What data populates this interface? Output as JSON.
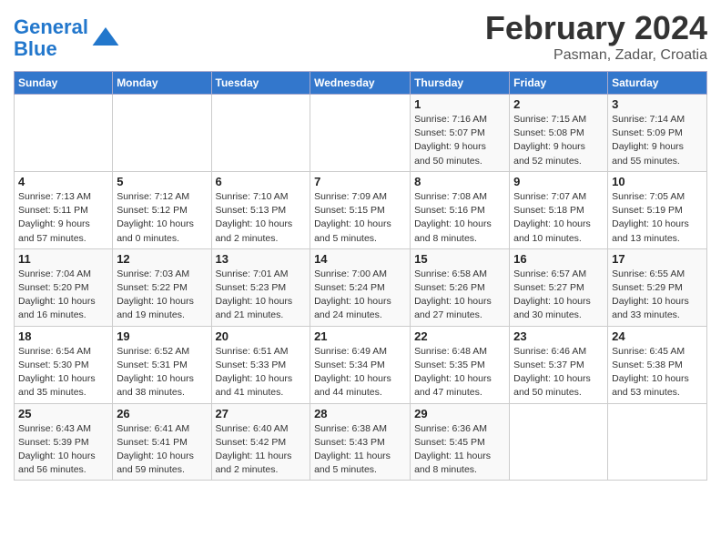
{
  "logo": {
    "line1": "General",
    "line2": "Blue"
  },
  "title": "February 2024",
  "location": "Pasman, Zadar, Croatia",
  "days_of_week": [
    "Sunday",
    "Monday",
    "Tuesday",
    "Wednesday",
    "Thursday",
    "Friday",
    "Saturday"
  ],
  "weeks": [
    [
      {
        "day": "",
        "info": ""
      },
      {
        "day": "",
        "info": ""
      },
      {
        "day": "",
        "info": ""
      },
      {
        "day": "",
        "info": ""
      },
      {
        "day": "1",
        "info": "Sunrise: 7:16 AM\nSunset: 5:07 PM\nDaylight: 9 hours\nand 50 minutes."
      },
      {
        "day": "2",
        "info": "Sunrise: 7:15 AM\nSunset: 5:08 PM\nDaylight: 9 hours\nand 52 minutes."
      },
      {
        "day": "3",
        "info": "Sunrise: 7:14 AM\nSunset: 5:09 PM\nDaylight: 9 hours\nand 55 minutes."
      }
    ],
    [
      {
        "day": "4",
        "info": "Sunrise: 7:13 AM\nSunset: 5:11 PM\nDaylight: 9 hours\nand 57 minutes."
      },
      {
        "day": "5",
        "info": "Sunrise: 7:12 AM\nSunset: 5:12 PM\nDaylight: 10 hours\nand 0 minutes."
      },
      {
        "day": "6",
        "info": "Sunrise: 7:10 AM\nSunset: 5:13 PM\nDaylight: 10 hours\nand 2 minutes."
      },
      {
        "day": "7",
        "info": "Sunrise: 7:09 AM\nSunset: 5:15 PM\nDaylight: 10 hours\nand 5 minutes."
      },
      {
        "day": "8",
        "info": "Sunrise: 7:08 AM\nSunset: 5:16 PM\nDaylight: 10 hours\nand 8 minutes."
      },
      {
        "day": "9",
        "info": "Sunrise: 7:07 AM\nSunset: 5:18 PM\nDaylight: 10 hours\nand 10 minutes."
      },
      {
        "day": "10",
        "info": "Sunrise: 7:05 AM\nSunset: 5:19 PM\nDaylight: 10 hours\nand 13 minutes."
      }
    ],
    [
      {
        "day": "11",
        "info": "Sunrise: 7:04 AM\nSunset: 5:20 PM\nDaylight: 10 hours\nand 16 minutes."
      },
      {
        "day": "12",
        "info": "Sunrise: 7:03 AM\nSunset: 5:22 PM\nDaylight: 10 hours\nand 19 minutes."
      },
      {
        "day": "13",
        "info": "Sunrise: 7:01 AM\nSunset: 5:23 PM\nDaylight: 10 hours\nand 21 minutes."
      },
      {
        "day": "14",
        "info": "Sunrise: 7:00 AM\nSunset: 5:24 PM\nDaylight: 10 hours\nand 24 minutes."
      },
      {
        "day": "15",
        "info": "Sunrise: 6:58 AM\nSunset: 5:26 PM\nDaylight: 10 hours\nand 27 minutes."
      },
      {
        "day": "16",
        "info": "Sunrise: 6:57 AM\nSunset: 5:27 PM\nDaylight: 10 hours\nand 30 minutes."
      },
      {
        "day": "17",
        "info": "Sunrise: 6:55 AM\nSunset: 5:29 PM\nDaylight: 10 hours\nand 33 minutes."
      }
    ],
    [
      {
        "day": "18",
        "info": "Sunrise: 6:54 AM\nSunset: 5:30 PM\nDaylight: 10 hours\nand 35 minutes."
      },
      {
        "day": "19",
        "info": "Sunrise: 6:52 AM\nSunset: 5:31 PM\nDaylight: 10 hours\nand 38 minutes."
      },
      {
        "day": "20",
        "info": "Sunrise: 6:51 AM\nSunset: 5:33 PM\nDaylight: 10 hours\nand 41 minutes."
      },
      {
        "day": "21",
        "info": "Sunrise: 6:49 AM\nSunset: 5:34 PM\nDaylight: 10 hours\nand 44 minutes."
      },
      {
        "day": "22",
        "info": "Sunrise: 6:48 AM\nSunset: 5:35 PM\nDaylight: 10 hours\nand 47 minutes."
      },
      {
        "day": "23",
        "info": "Sunrise: 6:46 AM\nSunset: 5:37 PM\nDaylight: 10 hours\nand 50 minutes."
      },
      {
        "day": "24",
        "info": "Sunrise: 6:45 AM\nSunset: 5:38 PM\nDaylight: 10 hours\nand 53 minutes."
      }
    ],
    [
      {
        "day": "25",
        "info": "Sunrise: 6:43 AM\nSunset: 5:39 PM\nDaylight: 10 hours\nand 56 minutes."
      },
      {
        "day": "26",
        "info": "Sunrise: 6:41 AM\nSunset: 5:41 PM\nDaylight: 10 hours\nand 59 minutes."
      },
      {
        "day": "27",
        "info": "Sunrise: 6:40 AM\nSunset: 5:42 PM\nDaylight: 11 hours\nand 2 minutes."
      },
      {
        "day": "28",
        "info": "Sunrise: 6:38 AM\nSunset: 5:43 PM\nDaylight: 11 hours\nand 5 minutes."
      },
      {
        "day": "29",
        "info": "Sunrise: 6:36 AM\nSunset: 5:45 PM\nDaylight: 11 hours\nand 8 minutes."
      },
      {
        "day": "",
        "info": ""
      },
      {
        "day": "",
        "info": ""
      }
    ]
  ]
}
